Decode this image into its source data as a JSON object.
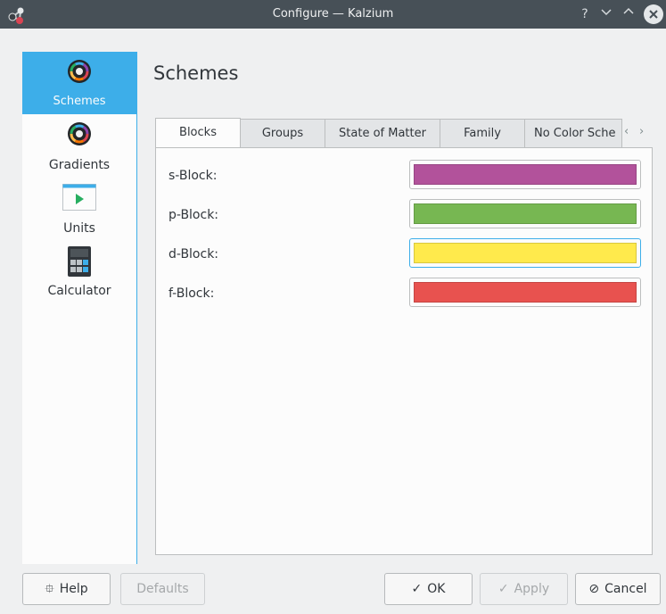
{
  "window": {
    "title": "Configure — Kalzium"
  },
  "titlebar": {
    "help_glyph": "?",
    "minimize_glyph": "⌄",
    "maximize_glyph": "^",
    "close_glyph": "✕"
  },
  "sidebar": {
    "items": [
      {
        "label": "Schemes",
        "icon": "color-wheel-icon",
        "selected": true
      },
      {
        "label": "Gradients",
        "icon": "color-wheel-icon",
        "selected": false
      },
      {
        "label": "Units",
        "icon": "units-window-icon",
        "selected": false
      },
      {
        "label": "Calculator",
        "icon": "calculator-icon",
        "selected": false
      }
    ]
  },
  "page": {
    "heading": "Schemes"
  },
  "tabs": {
    "items": [
      {
        "label": "Blocks",
        "active": true
      },
      {
        "label": "Groups",
        "active": false
      },
      {
        "label": "State of Matter",
        "active": false
      },
      {
        "label": "Family",
        "active": false
      },
      {
        "label": "No Color Sche",
        "active": false
      }
    ],
    "scroll_left_glyph": "‹",
    "scroll_right_glyph": "›"
  },
  "blocks": {
    "rows": [
      {
        "label": "s-Block:",
        "color": "#b2529b"
      },
      {
        "label": "p-Block:",
        "color": "#77b752"
      },
      {
        "label": "d-Block:",
        "color": "#ffea4c"
      },
      {
        "label": "f-Block:",
        "color": "#e8524f"
      }
    ]
  },
  "buttons": {
    "help": {
      "label": "Help",
      "icon": "help-lifebuoy-icon",
      "glyph": "⯐"
    },
    "defaults": {
      "label": "Defaults",
      "disabled": true
    },
    "ok": {
      "label": "OK",
      "icon": "check-icon",
      "glyph": "✓"
    },
    "apply": {
      "label": "Apply",
      "icon": "check-icon",
      "glyph": "✓",
      "disabled": true
    },
    "cancel": {
      "label": "Cancel",
      "icon": "cancel-icon",
      "glyph": "⊘"
    }
  }
}
